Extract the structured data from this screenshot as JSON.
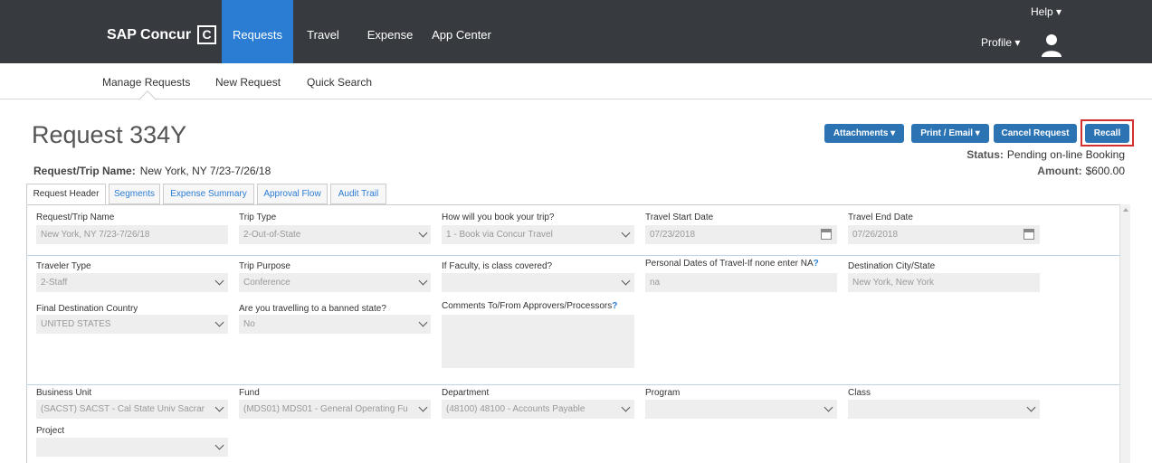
{
  "header": {
    "logo": "SAP Concur",
    "logo_mark": "C",
    "nav": [
      "Requests",
      "Travel",
      "Expense",
      "App Center"
    ],
    "help": "Help ▾",
    "profile": "Profile ▾"
  },
  "subnav": [
    "Manage Requests",
    "New Request",
    "Quick Search"
  ],
  "request": {
    "title": "Request 334Y",
    "trip_label": "Request/Trip Name:",
    "trip_value": "New York, NY 7/23-7/26/18",
    "status_label": "Status:",
    "status_value": "Pending on-line Booking",
    "amount_label": "Amount:",
    "amount_value": "$600.00"
  },
  "actions": {
    "attachments": "Attachments ▾",
    "print": "Print / Email ▾",
    "cancel": "Cancel Request",
    "recall": "Recall"
  },
  "tabs": [
    "Request Header",
    "Segments",
    "Expense Summary",
    "Approval Flow",
    "Audit Trail"
  ],
  "fields": {
    "trip_name": {
      "label": "Request/Trip Name",
      "value": "New York, NY 7/23-7/26/18"
    },
    "trip_type": {
      "label": "Trip Type",
      "value": "2-Out-of-State"
    },
    "booking": {
      "label": "How will you book your trip?",
      "value": "1 - Book via Concur Travel"
    },
    "start_date": {
      "label": "Travel Start Date",
      "value": "07/23/2018"
    },
    "end_date": {
      "label": "Travel End Date",
      "value": "07/26/2018"
    },
    "traveler_type": {
      "label": "Traveler Type",
      "value": "2-Staff"
    },
    "trip_purpose": {
      "label": "Trip Purpose",
      "value": "Conference"
    },
    "faculty": {
      "label": "If Faculty, is class covered?",
      "value": ""
    },
    "personal_dates": {
      "label": "Personal Dates of Travel-If none enter NA",
      "help": "?",
      "value": "na"
    },
    "destination": {
      "label": "Destination City/State",
      "value": "New York, New York"
    },
    "country": {
      "label": "Final Destination Country",
      "value": "UNITED STATES"
    },
    "banned": {
      "label": "Are you travelling to a banned state?",
      "value": "No"
    },
    "comments": {
      "label": "Comments To/From Approvers/Processors",
      "help": "?",
      "value": ""
    },
    "business_unit": {
      "label": "Business Unit",
      "value": "(SACST) SACST - Cal State Univ Sacrar"
    },
    "fund": {
      "label": "Fund",
      "value": "(MDS01) MDS01 - General Operating Fu"
    },
    "department": {
      "label": "Department",
      "value": "(48100) 48100 - Accounts Payable"
    },
    "program": {
      "label": "Program",
      "value": ""
    },
    "class": {
      "label": "Class",
      "value": ""
    },
    "project": {
      "label": "Project",
      "value": ""
    }
  },
  "colors": {
    "topbar": "#373a3f",
    "nav_active": "#2b7cd3",
    "button": "#2c73b4",
    "highlight": "#d32f2f"
  }
}
